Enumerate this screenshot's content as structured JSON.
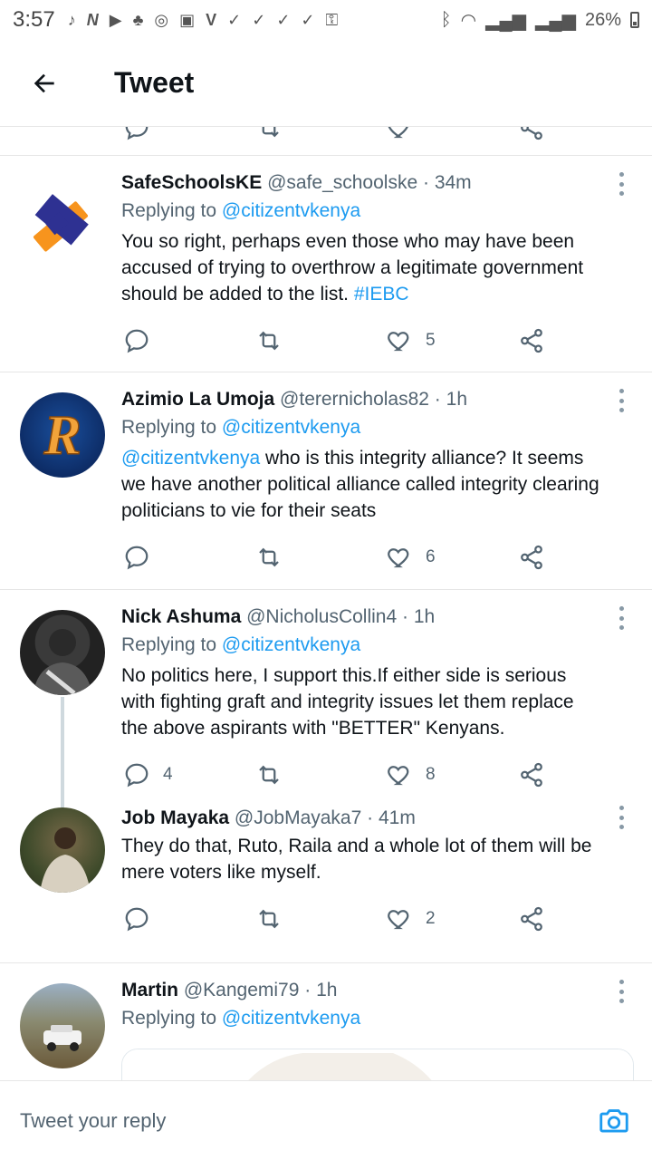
{
  "status_bar": {
    "time": "3:57",
    "battery": "26%"
  },
  "header": {
    "title": "Tweet"
  },
  "replying_label": "Replying to",
  "tweets": [
    {
      "name": "SafeSchoolsKE",
      "handle": "@safe_schoolske",
      "time": "34m",
      "replying_to": "@citizentvkenya",
      "text": "You so right, perhaps even those who may have been accused of trying to overthrow a legitimate government should be added to the list. ",
      "hashtag": "#IEBC",
      "replies": "",
      "retweets": "",
      "likes": "5"
    },
    {
      "name": "Azimio La Umoja",
      "handle": "@terernicholas82",
      "time": "1h",
      "replying_to": "@citizentvkenya",
      "mention": "@citizentvkenya",
      "text": " who is this integrity alliance? It seems we have another political alliance called integrity clearing politicians to vie for their seats",
      "replies": "",
      "retweets": "",
      "likes": "6"
    },
    {
      "name": "Nick Ashuma",
      "handle": "@NicholusCollin4",
      "time": "1h",
      "replying_to": "@citizentvkenya",
      "text": "No politics here, I support this.If either side is serious with fighting graft and integrity issues let them replace the above aspirants with \"BETTER\" Kenyans.",
      "replies": "4",
      "retweets": "",
      "likes": "8"
    },
    {
      "name": "Job Mayaka",
      "handle": "@JobMayaka7",
      "time": "41m",
      "text": "They do that, Ruto, Raila and a whole lot of them will be mere voters like myself.",
      "replies": "",
      "retweets": "",
      "likes": "2"
    },
    {
      "name": "Martin",
      "handle": "@Kangemi79",
      "time": "1h",
      "replying_to": "@citizentvkenya"
    }
  ],
  "reply_bar": {
    "placeholder": "Tweet your reply"
  },
  "colors": {
    "accent": "#1d9bf0",
    "secondary_text": "#536471",
    "divider": "#e6e6e6"
  }
}
